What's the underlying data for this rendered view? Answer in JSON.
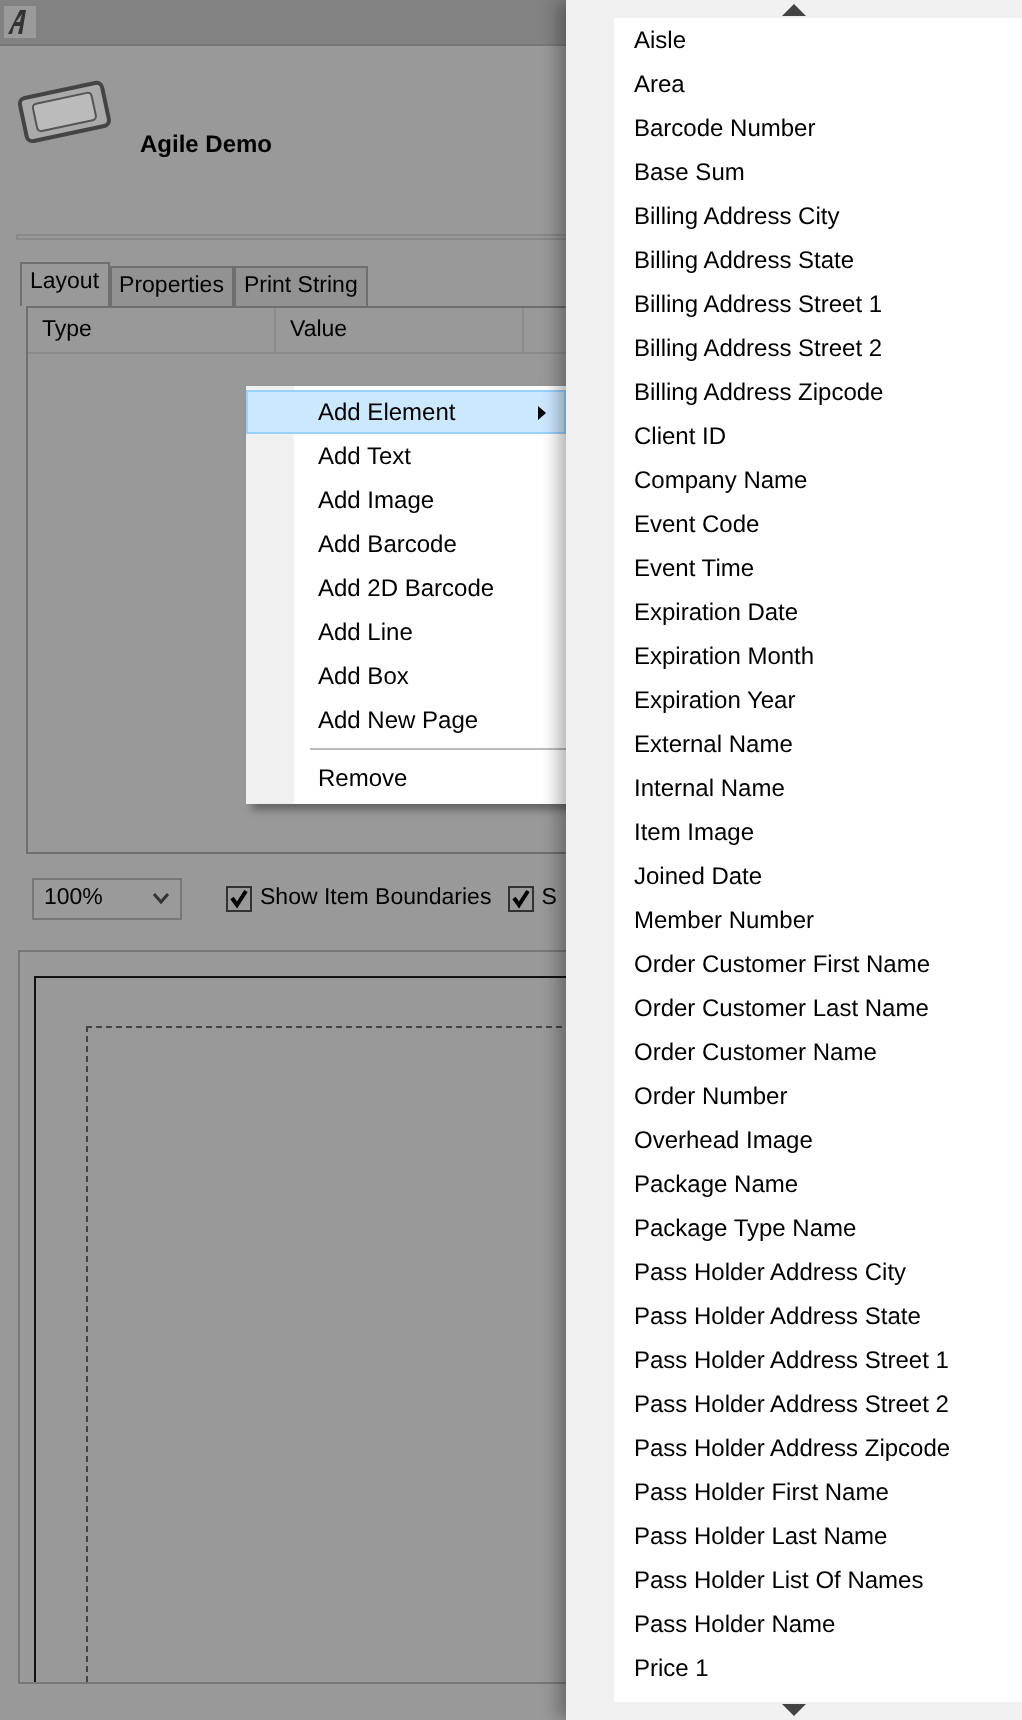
{
  "app": {
    "title": "Agile Demo"
  },
  "tabs": [
    {
      "label": "Layout",
      "selected": true
    },
    {
      "label": "Properties",
      "selected": false
    },
    {
      "label": "Print String",
      "selected": false
    }
  ],
  "grid": {
    "columns": [
      "Type",
      "Value"
    ]
  },
  "zoom": {
    "value": "100%"
  },
  "options": [
    {
      "label": "Show Item Boundaries",
      "checked": true
    },
    {
      "label": "S",
      "checked": true
    }
  ],
  "context_menu": {
    "items": [
      {
        "kind": "item",
        "label": "Add Element",
        "selected": true,
        "has_submenu": true
      },
      {
        "kind": "item",
        "label": "Add Text",
        "selected": false,
        "has_submenu": false
      },
      {
        "kind": "item",
        "label": "Add Image",
        "selected": false,
        "has_submenu": false
      },
      {
        "kind": "item",
        "label": "Add Barcode",
        "selected": false,
        "has_submenu": false
      },
      {
        "kind": "item",
        "label": "Add 2D Barcode",
        "selected": false,
        "has_submenu": false
      },
      {
        "kind": "item",
        "label": "Add Line",
        "selected": false,
        "has_submenu": false
      },
      {
        "kind": "item",
        "label": "Add Box",
        "selected": false,
        "has_submenu": false
      },
      {
        "kind": "item",
        "label": "Add New Page",
        "selected": false,
        "has_submenu": false
      },
      {
        "kind": "separator"
      },
      {
        "kind": "item",
        "label": "Remove",
        "selected": false,
        "has_submenu": false
      }
    ]
  },
  "submenu": {
    "items": [
      "Aisle",
      "Area",
      "Barcode Number",
      "Base Sum",
      "Billing Address City",
      "Billing Address State",
      "Billing Address Street 1",
      "Billing Address Street 2",
      "Billing Address Zipcode",
      "Client ID",
      "Company Name",
      "Event Code",
      "Event Time",
      "Expiration Date",
      "Expiration Month",
      "Expiration Year",
      "External Name",
      "Internal Name",
      "Item Image",
      "Joined Date",
      "Member Number",
      "Order Customer First Name",
      "Order Customer Last Name",
      "Order Customer Name",
      "Order Number",
      "Overhead Image",
      "Package Name",
      "Package Type Name",
      "Pass Holder Address City",
      "Pass Holder Address State",
      "Pass Holder Address Street 1",
      "Pass Holder Address Street 2",
      "Pass Holder Address Zipcode",
      "Pass Holder First Name",
      "Pass Holder Last Name",
      "Pass Holder List Of Names",
      "Pass Holder Name",
      "Price 1"
    ]
  }
}
